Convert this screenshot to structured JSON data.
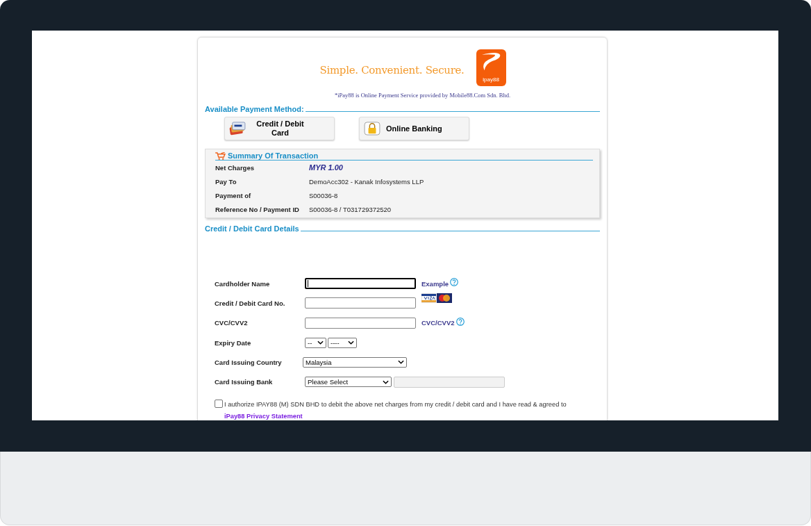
{
  "header": {
    "tagline": "Simple. Convenient. Secure.",
    "logo_text": "ipay88",
    "footnote": "*iPay88 is Online Payment Service provided by Mobile88.Com Sdn. Bhd."
  },
  "payment_section": {
    "title": "Available Payment Method:"
  },
  "payment_methods": [
    {
      "label": "Credit / Debit Card",
      "kind": "card"
    },
    {
      "label": "Online Banking",
      "kind": "bank"
    }
  ],
  "summary": {
    "title": "Summary Of Transaction",
    "rows": [
      {
        "label": "Net Charges",
        "value": "MYR 1.00",
        "kind": "amount"
      },
      {
        "label": "Pay To",
        "value": "DemoAcc302 - Kanak Infosystems LLP",
        "kind": "plain"
      },
      {
        "label": "Payment of",
        "value": "S00036-8",
        "kind": "plain"
      },
      {
        "label": "Reference No / Payment ID",
        "value": "S00036-8 / T031729372520",
        "kind": "plain"
      }
    ]
  },
  "card_details": {
    "title": "Credit / Debit Card Details",
    "fields": [
      {
        "label": "Cardholder Name",
        "kind": "text",
        "focused": true,
        "help": "Example"
      },
      {
        "label": "Credit / Debit Card No.",
        "kind": "text",
        "focused": false,
        "logos": true
      },
      {
        "label": "CVC/CVV2",
        "kind": "text",
        "focused": false,
        "help": "CVC/CVV2"
      },
      {
        "label": "Expiry Date",
        "kind": "pair",
        "options": [
          "--",
          "----"
        ]
      },
      {
        "label": "Card Issuing Country",
        "kind": "select",
        "value": "Malaysia"
      },
      {
        "label": "Card Issuing Bank",
        "kind": "bank",
        "value": "Please Select",
        "disabled": true
      }
    ]
  },
  "consent": {
    "checked": false,
    "text": "I authorize IPAY88 (M) SDN BHD to debit the above net charges from my credit / debit card and I have read & agreed to",
    "link": "iPay88 Privacy Statement"
  }
}
